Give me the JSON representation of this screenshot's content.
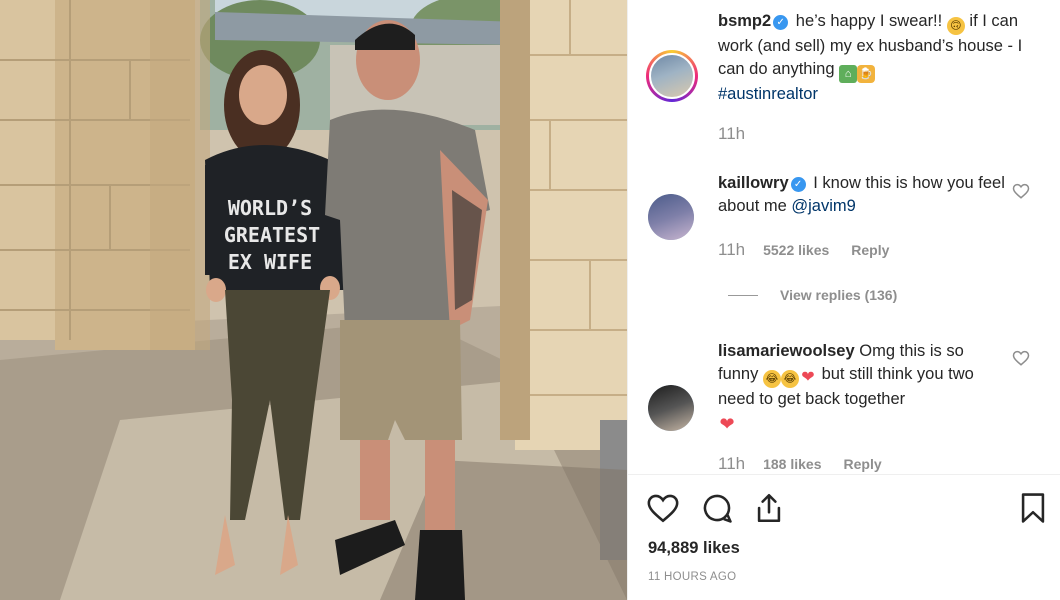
{
  "post": {
    "author": "bsmp2",
    "caption_text": "he’s happy I swear!!",
    "caption_text2": "if I can work (and sell) my ex husband’s house - I can do anything",
    "hashtag": "#austinrealtor",
    "time": "11h"
  },
  "photo": {
    "shirt_text": [
      "WORLD’S",
      "GREATEST",
      "EX WIFE"
    ]
  },
  "comments": [
    {
      "username": "kaillowry",
      "verified": true,
      "text": "I know this is how you feel about me",
      "mention": "@javim9",
      "time": "11h",
      "likes": "5522 likes",
      "reply": "Reply",
      "view_replies": "View replies (136)"
    },
    {
      "username": "lisamariewoolsey",
      "verified": false,
      "text_part1": "Omg this is so funny",
      "text_part2": "but still think you two need to get back together",
      "time": "11h",
      "likes": "188 likes",
      "reply": "Reply"
    }
  ],
  "footer": {
    "likes": "94,889 likes",
    "timestamp": "11 HOURS AGO"
  },
  "icons": {
    "like": "heart-icon",
    "comment": "comment-icon",
    "share": "share-icon",
    "save": "bookmark-icon"
  },
  "colors": {
    "verified": "#3897f0",
    "link": "#003569",
    "muted": "#8e8e8e",
    "heart_red": "#ed4956"
  }
}
